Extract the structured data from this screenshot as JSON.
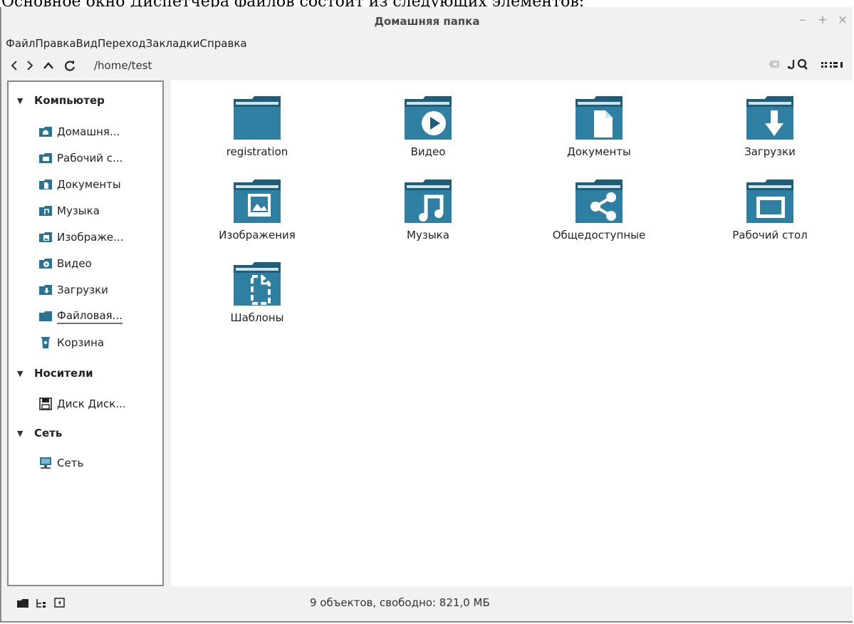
{
  "caption": "Основное окно Диспетчера файлов состоит из следующих элементов:",
  "window": {
    "title": "Домашняя папка"
  },
  "window_controls": {
    "minimize": "–",
    "maximize": "+",
    "close": "×"
  },
  "menu": [
    "Файл",
    "Правка",
    "Вид",
    "Переход",
    "Закладки",
    "Справка"
  ],
  "toolbar": {
    "path": "/home/test"
  },
  "sidebar": {
    "sections": [
      {
        "label": "Компьютер",
        "items": [
          {
            "label": "Домашня...",
            "icon": "home-folder-icon"
          },
          {
            "label": "Рабочий с...",
            "icon": "desktop-folder-icon"
          },
          {
            "label": "Документы",
            "icon": "documents-folder-icon"
          },
          {
            "label": "Музыка",
            "icon": "music-folder-icon"
          },
          {
            "label": "Изображе...",
            "icon": "pictures-folder-icon"
          },
          {
            "label": "Видео",
            "icon": "videos-folder-icon"
          },
          {
            "label": "Загрузки",
            "icon": "downloads-folder-icon"
          },
          {
            "label": "Файловая...",
            "icon": "filesystem-folder-icon"
          },
          {
            "label": "Корзина",
            "icon": "trash-icon"
          }
        ]
      },
      {
        "label": "Носители",
        "items": [
          {
            "label": "Диск Диск...",
            "icon": "disk-icon"
          }
        ]
      },
      {
        "label": "Сеть",
        "items": [
          {
            "label": "Сеть",
            "icon": "network-icon"
          }
        ]
      }
    ]
  },
  "files": [
    {
      "name": "registration",
      "icon": "folder-icon"
    },
    {
      "name": "Видео",
      "icon": "videos-folder-icon"
    },
    {
      "name": "Документы",
      "icon": "documents-folder-icon"
    },
    {
      "name": "Загрузки",
      "icon": "downloads-folder-icon"
    },
    {
      "name": "Изображения",
      "icon": "pictures-folder-icon"
    },
    {
      "name": "Музыка",
      "icon": "music-folder-icon"
    },
    {
      "name": "Общедоступные",
      "icon": "share-folder-icon"
    },
    {
      "name": "Рабочий стол",
      "icon": "desktop-folder-icon"
    },
    {
      "name": "Шаблоны",
      "icon": "templates-folder-icon"
    }
  ],
  "status": {
    "text": "9 объектов, свободно: 821,0 МБ"
  },
  "colors": {
    "folder_dark": "#1f5d78",
    "folder_light": "#3f8fb0",
    "folder_tab": "#cfe3ec"
  }
}
